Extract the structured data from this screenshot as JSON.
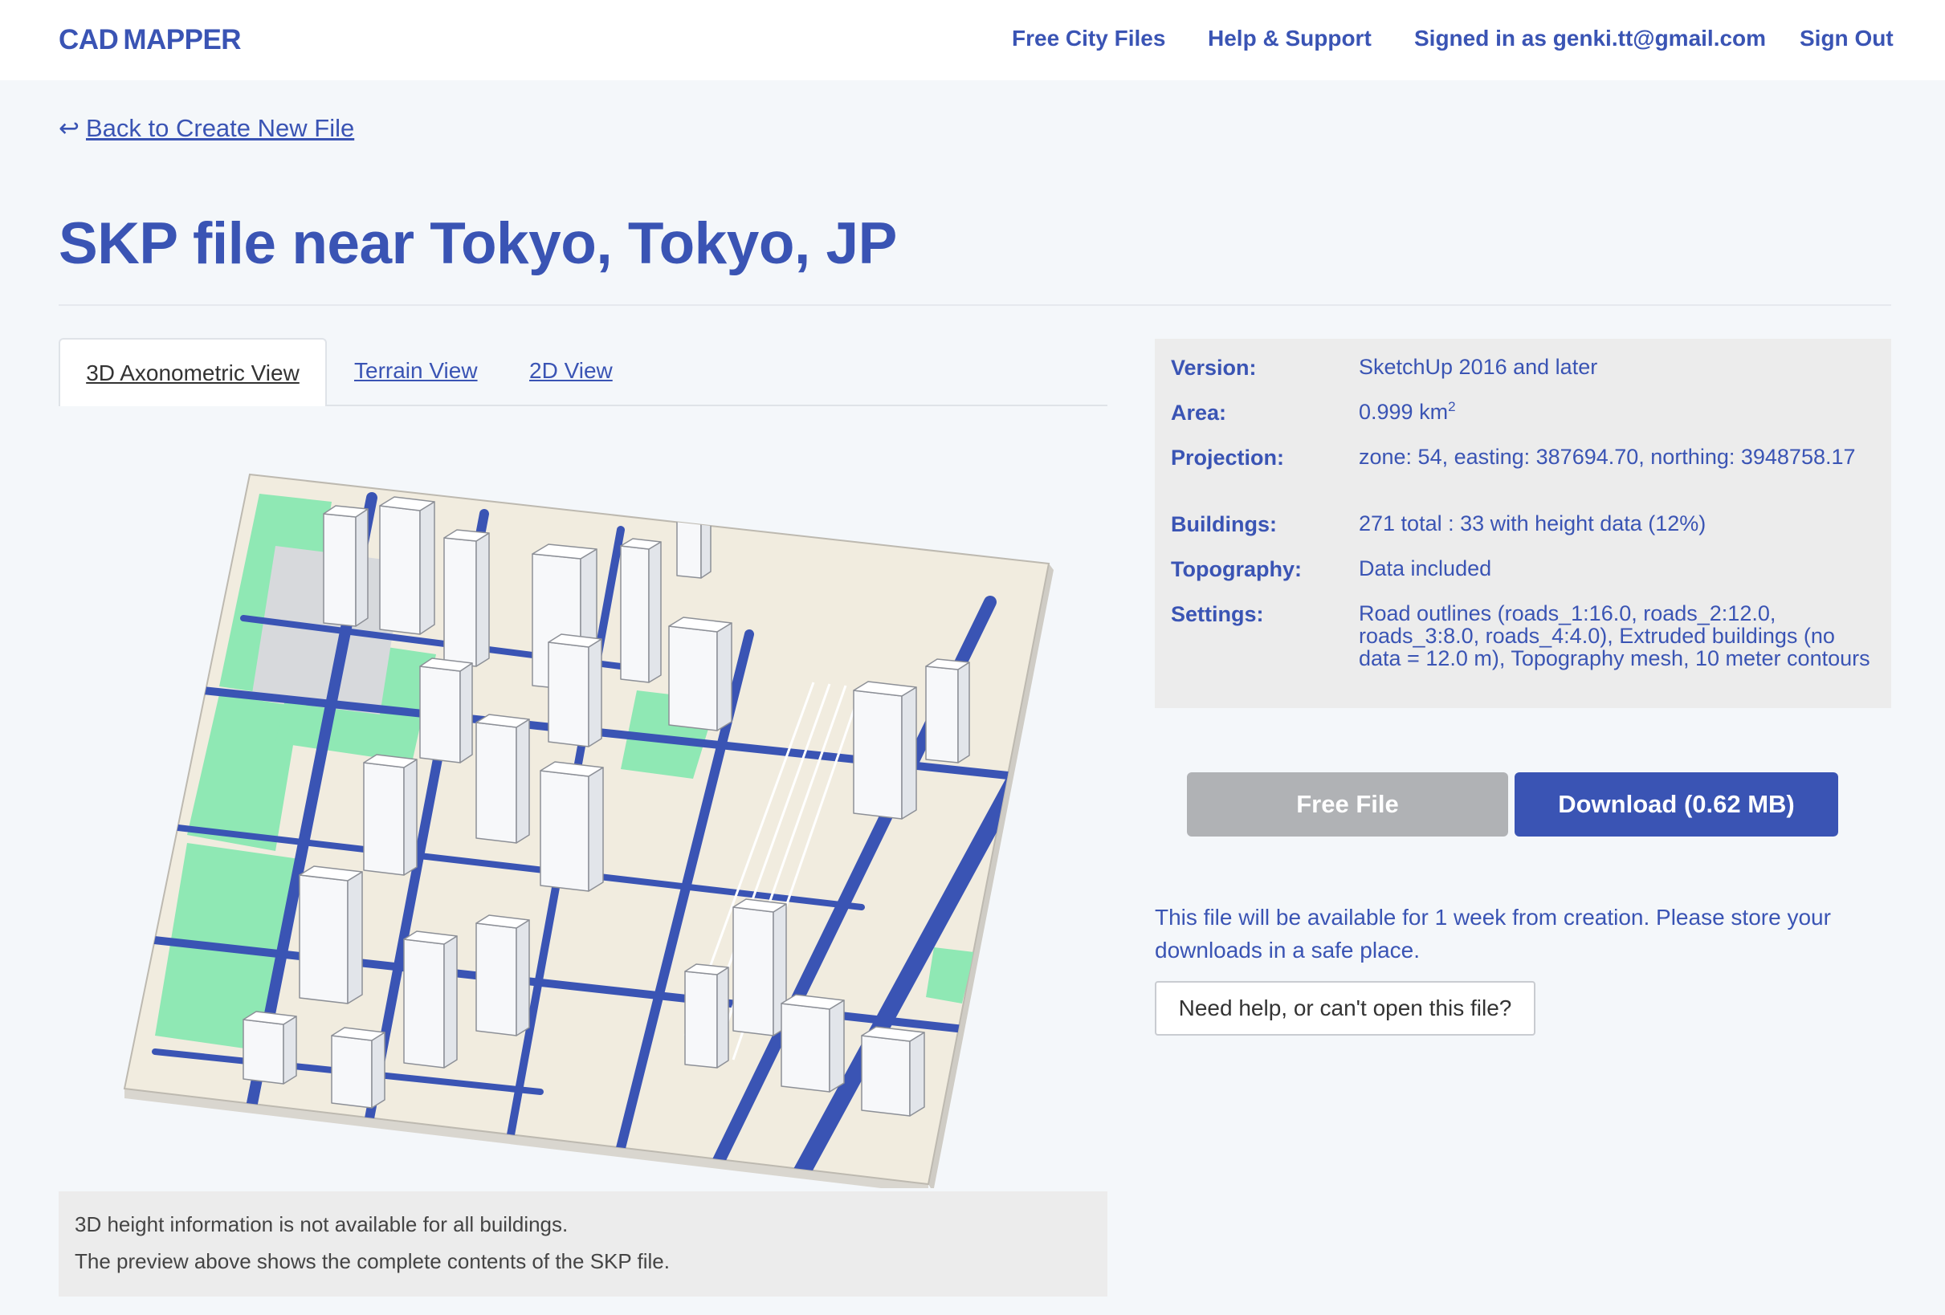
{
  "header": {
    "logo_part1": "CAD",
    "logo_part2": "MAPPER",
    "nav": {
      "free_city_files": "Free City Files",
      "help_support": "Help & Support",
      "signed_in": "Signed in as genki.tt@gmail.com",
      "sign_out": "Sign Out"
    }
  },
  "back_link": {
    "arrow": "↩",
    "label": "Back to Create New File"
  },
  "page_title": "SKP file near Tokyo, Tokyo, JP",
  "tabs": [
    {
      "label": "3D Axonometric View",
      "active": true
    },
    {
      "label": "Terrain View",
      "active": false
    },
    {
      "label": "2D View",
      "active": false
    }
  ],
  "preview_note": {
    "line1": "3D height information is not available for all buildings.",
    "line2": "The preview above shows the complete contents of the SKP file."
  },
  "info": {
    "version": {
      "label": "Version:",
      "value": "SketchUp 2016 and later"
    },
    "area": {
      "label": "Area:",
      "value": "0.999 km",
      "sup": "2"
    },
    "projection": {
      "label": "Projection:",
      "value": "zone: 54, easting: 387694.70, northing: 3948758.17"
    },
    "buildings": {
      "label": "Buildings:",
      "value": "271 total : 33 with height data (12%)"
    },
    "topography": {
      "label": "Topography:",
      "value": "Data included"
    },
    "settings": {
      "label": "Settings:",
      "value": "Road outlines (roads_1:16.0, roads_2:12.0, roads_3:8.0, roads_4:4.0), Extruded buildings (no data = 12.0 m), Topography mesh, 10 meter contours"
    }
  },
  "buttons": {
    "free_file": "Free File",
    "download": "Download (0.62 MB)"
  },
  "availability_text": "This file will be available for 1 week from creation. Please store your downloads in a safe place.",
  "help_button": "Need help, or can't open this file?",
  "colors": {
    "brand": "#3a54b4",
    "background": "#f4f7fa",
    "panel": "#ececec",
    "park": "#8fe8b4",
    "disabled": "#b0b2b5"
  }
}
